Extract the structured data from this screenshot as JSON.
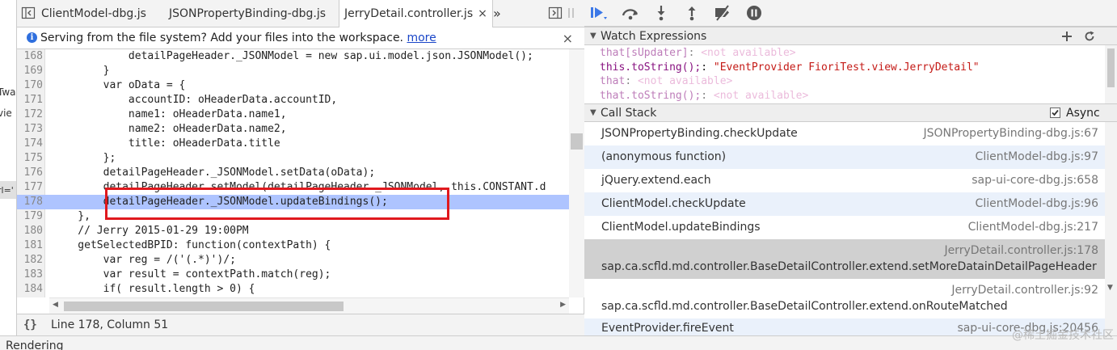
{
  "left_strip": {
    "fragments": [
      "Twa",
      "vie",
      "rl='"
    ]
  },
  "editor": {
    "tabs": [
      {
        "label": "ClientModel-dbg.js"
      },
      {
        "label": "JSONPropertyBinding-dbg.js"
      },
      {
        "label": "JerryDetail.controller.js",
        "close": "×"
      }
    ],
    "tab_overflow": "»",
    "infobar": {
      "message": "Serving from the file system? Add your files into the workspace.",
      "link": "more",
      "close": "×"
    },
    "lines": [
      {
        "n": "168",
        "text": "            detailPageHeader._JSONModel = new sap.ui.model.json.JSONModel();"
      },
      {
        "n": "169",
        "text": "        }"
      },
      {
        "n": "170",
        "text": "        var oData = {"
      },
      {
        "n": "171",
        "text": "            accountID: oHeaderData.accountID,"
      },
      {
        "n": "172",
        "text": "            name1: oHeaderData.name1,"
      },
      {
        "n": "173",
        "text": "            name2: oHeaderData.name2,"
      },
      {
        "n": "174",
        "text": "            title: oHeaderData.title"
      },
      {
        "n": "175",
        "text": "        };"
      },
      {
        "n": "176",
        "text": "        detailPageHeader._JSONModel.setData(oData);"
      },
      {
        "n": "177",
        "text": "        detailPageHeader.setModel(detailPageHeader._JSONModel, this.CONSTANT.d"
      },
      {
        "n": "178",
        "text": "        detailPageHeader._JSONModel.updateBindings();"
      },
      {
        "n": "179",
        "text": "    },"
      },
      {
        "n": "180",
        "text": "    // Jerry 2015-01-29 19:00PM"
      },
      {
        "n": "181",
        "text": "    getSelectedBPID: function(contextPath) {"
      },
      {
        "n": "182",
        "text": "        var reg = /('(.*)')/;"
      },
      {
        "n": "183",
        "text": "        var result = contextPath.match(reg);"
      },
      {
        "n": "184",
        "text": "        if( result.length > 0) {"
      },
      {
        "n": "185",
        "text": ""
      }
    ],
    "status": {
      "braces": "{}",
      "position": "Line 178, Column 51"
    }
  },
  "watch": {
    "title": "Watch Expressions",
    "items": [
      {
        "name": "that[sUpdater]",
        "sep": ": ",
        "value": "<not available>",
        "available": false
      },
      {
        "name": "this.toString();",
        "sep": ": ",
        "value": "\"EventProvider FioriTest.view.JerryDetail\"",
        "available": true
      },
      {
        "name": "that",
        "sep": ": ",
        "value": "<not available>",
        "available": false
      },
      {
        "name": "that.toString();",
        "sep": ": ",
        "value": "<not available>",
        "available": false
      }
    ]
  },
  "callstack": {
    "title": "Call Stack",
    "async_label": "Async",
    "async_checked": true,
    "frames": [
      {
        "fn": "JSONPropertyBinding.checkUpdate",
        "loc": "JSONPropertyBinding-dbg.js:67"
      },
      {
        "fn": "(anonymous function)",
        "loc": "ClientModel-dbg.js:97"
      },
      {
        "fn": "jQuery.extend.each",
        "loc": "sap-ui-core-dbg.js:658"
      },
      {
        "fn": "ClientModel.checkUpdate",
        "loc": "ClientModel-dbg.js:96"
      },
      {
        "fn": "ClientModel.updateBindings",
        "loc": "ClientModel-dbg.js:217"
      },
      {
        "fn": "sap.ca.scfld.md.controller.BaseDetailController.extend.setMoreDatainDetailPageHeader",
        "loc": "JerryDetail.controller.js:178"
      },
      {
        "fn": "sap.ca.scfld.md.controller.BaseDetailController.extend.onRouteMatched",
        "loc": "JerryDetail.controller.js:92"
      },
      {
        "fn": "EventProvider.fireEvent",
        "loc": "sap-ui-core-dbg.js:20456"
      }
    ]
  },
  "bottom": {
    "label": "Rendering"
  },
  "watermark": "@稀土掘金技术社区",
  "colors": {
    "exec_line": "#aec4ff",
    "highlight_box": "#e0191e",
    "selected_frame": "#d0d0d0",
    "link": "#1a46c8"
  }
}
